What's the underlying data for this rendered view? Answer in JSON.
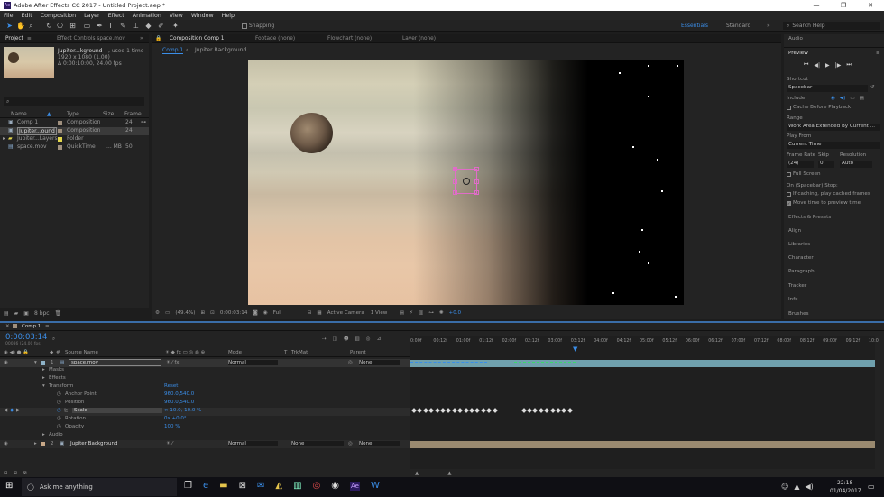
{
  "window": {
    "title": "Adobe After Effects CC 2017 - Untitled Project.aep *",
    "min": "—",
    "max": "❐",
    "close": "✕"
  },
  "menu": [
    "File",
    "Edit",
    "Composition",
    "Layer",
    "Effect",
    "Animation",
    "View",
    "Window",
    "Help"
  ],
  "toolbar": {
    "snapping": "Snapping",
    "workspaces": [
      "Essentials",
      "Standard"
    ],
    "search_placeholder": "Search Help"
  },
  "project": {
    "tab": "Project",
    "effect_tab": "Effect Controls space.mov",
    "selected": {
      "name": "Jupiter...kground",
      "used": ", used 1 time",
      "res": "1920 x 1080 (1.00)",
      "dur": "Δ 0:00:10:00, 24.00 fps"
    },
    "headers": [
      "Name",
      "Type",
      "Size",
      "Frame ..."
    ],
    "items": [
      {
        "name": "Comp 1",
        "type": "Composition",
        "size": "",
        "fr": "24",
        "color": "#a0907e"
      },
      {
        "name": "Jupiter...ound",
        "type": "Composition",
        "size": "",
        "fr": "24",
        "color": "#a0907e"
      },
      {
        "name": "Jupiter...Layers",
        "type": "Folder",
        "size": "",
        "fr": "",
        "color": "#e4d84c"
      },
      {
        "name": "space.mov",
        "type": "QuickTime",
        "size": "... MB",
        "fr": "50",
        "color": "#a0907e"
      }
    ],
    "bpc": "8 bpc"
  },
  "composition": {
    "tabs": [
      "Composition Comp 1",
      "Footage (none)",
      "Flowchart (none)",
      "Layer (none)"
    ],
    "sub": [
      "Comp 1",
      "Jupiter Background"
    ],
    "zoom": "(49.4%)",
    "time": "0:00:03:14",
    "res": "Full",
    "camera": "Active Camera",
    "views": "1 View",
    "exposure": "+0.0"
  },
  "right": {
    "audio": "Audio",
    "preview": "Preview",
    "shortcut_lbl": "Shortcut",
    "shortcut": "Spacebar",
    "include": "Include:",
    "cache": "Cache Before Playback",
    "range_lbl": "Range",
    "range": "Work Area Extended By Current ...",
    "playfrom_lbl": "Play From",
    "playfrom": "Current Time",
    "fr_lbl": "Frame Rate",
    "skip_lbl": "Skip",
    "res_lbl": "Resolution",
    "fr": "(24)",
    "skip": "0",
    "res": "Auto",
    "fullscreen": "Full Screen",
    "stop": "On (Spacebar) Stop:",
    "ifcaching": "If caching, play cached frames",
    "movetime": "Move time to preview time",
    "panels": [
      "Effects & Presets",
      "Align",
      "Libraries",
      "Character",
      "Paragraph",
      "Tracker",
      "Info",
      "Brushes"
    ]
  },
  "timeline": {
    "tab": "Comp 1",
    "time": "0:00:03:14",
    "frames": "00086 (24.00 fps)",
    "cols": {
      "src": "Source Name",
      "mode": "Mode",
      "t": "T",
      "trk": "TrkMat",
      "parent": "Parent"
    },
    "ruler": [
      "0:00f",
      "00:12f",
      "01:00f",
      "01:12f",
      "02:00f",
      "02:12f",
      "03:00f",
      "03:12f",
      "04:00f",
      "04:12f",
      "05:00f",
      "05:12f",
      "06:00f",
      "06:12f",
      "07:00f",
      "07:12f",
      "08:00f",
      "08:12f",
      "09:00f",
      "09:12f",
      "10:0"
    ],
    "layer1": {
      "num": "1",
      "name": "space.mov",
      "mode": "Normal",
      "parent": "None"
    },
    "masks": "Masks",
    "effects": "Effects",
    "transform": "Transform",
    "reset": "Reset",
    "props": [
      {
        "name": "Anchor Point",
        "val": "960.0,540.0"
      },
      {
        "name": "Position",
        "val": "960.0,540.0"
      },
      {
        "name": "Scale",
        "val": "∞ 10.0, 10.0 %"
      },
      {
        "name": "Rotation",
        "val": "0x +0.0°"
      },
      {
        "name": "Opacity",
        "val": "100 %"
      }
    ],
    "audio": "Audio",
    "layer2": {
      "num": "2",
      "name": "Jupiter Background",
      "mode": "Normal",
      "trk": "None",
      "parent": "None"
    }
  },
  "taskbar": {
    "search": "Ask me anything",
    "time": "22:18",
    "date": "01/04/2017"
  }
}
